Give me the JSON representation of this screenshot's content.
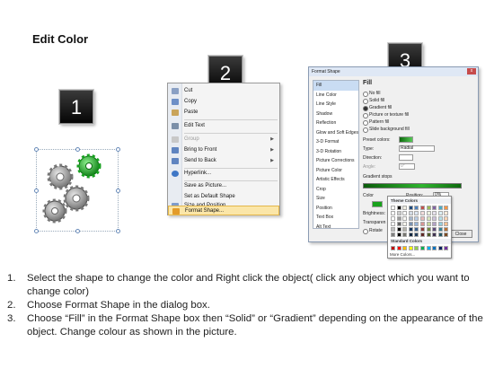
{
  "title": "Edit Color",
  "badges": [
    "1",
    "2",
    "3"
  ],
  "context_menu": {
    "items": [
      {
        "label": "Cut",
        "icon": "scissors-icon",
        "disabled": false
      },
      {
        "label": "Copy",
        "icon": "copy-icon",
        "disabled": false
      },
      {
        "label": "Paste",
        "icon": "paste-icon",
        "disabled": false
      },
      {
        "label": "Edit Text",
        "icon": "edit-text-icon",
        "disabled": false
      },
      {
        "label": "Group",
        "icon": "group-icon",
        "disabled": true,
        "submenu": true
      },
      {
        "label": "Bring to Front",
        "icon": "bring-front-icon",
        "disabled": false,
        "submenu": true
      },
      {
        "label": "Send to Back",
        "icon": "send-back-icon",
        "disabled": false,
        "submenu": true
      },
      {
        "label": "Hyperlink...",
        "icon": "hyperlink-icon",
        "disabled": false
      },
      {
        "label": "Save as Picture...",
        "icon": "",
        "disabled": false
      },
      {
        "label": "Set as Default Shape",
        "icon": "",
        "disabled": false
      },
      {
        "label": "Size and Position...",
        "icon": "size-position-icon",
        "disabled": false
      },
      {
        "label": "Format Shape...",
        "icon": "format-shape-icon",
        "disabled": false,
        "highlighted": true
      }
    ],
    "submenu_arrow": "▶"
  },
  "dialog": {
    "title": "Format Shape",
    "close": "x",
    "sidebar": [
      "Fill",
      "Line Color",
      "Line Style",
      "Shadow",
      "Reflection",
      "Glow and Soft Edges",
      "3-D Format",
      "3-D Rotation",
      "Picture Corrections",
      "Picture Color",
      "Artistic Effects",
      "Crop",
      "Size",
      "Position",
      "Text Box",
      "Alt Text"
    ],
    "fill_heading": "Fill",
    "radios": [
      "No fill",
      "Solid fill",
      "Gradient fill",
      "Picture or texture fill",
      "Pattern fill",
      "Slide background fill"
    ],
    "selected_radio": 2,
    "preset_label": "Preset colors:",
    "type_label": "Type:",
    "type_value": "Radial",
    "direction_label": "Direction:",
    "angle_label": "Angle:",
    "angle_value": "0°",
    "stops_label": "Gradient stops",
    "color_label": "Color",
    "position_label": "Position:",
    "position_value": "0%",
    "brightness_label": "Brightness:",
    "transparency_label": "Transparen",
    "rotate_label": "Rotate",
    "close_button": "Close"
  },
  "palette": {
    "theme_heading": "Theme Colors",
    "standard_heading": "Standard Colors",
    "more": "More Colors...",
    "theme_top": [
      "#ffffff",
      "#000000",
      "#eeece1",
      "#1f497d",
      "#4f81bd",
      "#c0504d",
      "#9bbb59",
      "#8064a2",
      "#4bacc6",
      "#f79646"
    ],
    "standard": [
      "#c00000",
      "#ff0000",
      "#ffc000",
      "#ffff00",
      "#92d050",
      "#00b050",
      "#00b0f0",
      "#0070c0",
      "#002060",
      "#7030a0"
    ]
  },
  "instructions": [
    {
      "num": "1.",
      "text": "Select the shape to change the color and Right click the object( click any object which you want to change color)"
    },
    {
      "num": "2.",
      "text": "Choose Format Shape in the dialog box."
    },
    {
      "num": "3.",
      "text": "Choose “Fill” in the Format Shape box then “Solid” or “Gradient” depending on the appearance of the object. Change colour as shown in the picture."
    }
  ]
}
